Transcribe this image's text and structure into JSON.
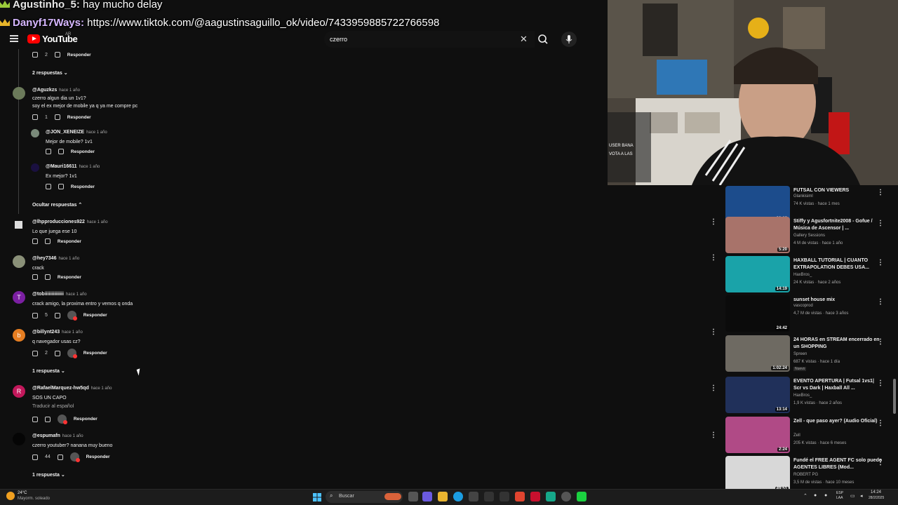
{
  "chat": {
    "line1_user": "Agustinho_5:",
    "line1_msg": "hay mucho delay",
    "line2_user": "Danyf17Ways:",
    "line2_msg": "https://www.tiktok.com/@aagustinsaguillo_ok/video/7433959885722766598"
  },
  "header": {
    "logo_text": "YouTube",
    "country": "AR",
    "search_value": "czerro"
  },
  "comments": [
    {
      "likes": "2",
      "reply": "Responder"
    },
    {
      "user": "@Aguzkzs",
      "time": "hace 1 año",
      "text1": "czerro algun dia un 1v1?",
      "text2": "soy el ex mejor de mobile ya q ya me compre pc",
      "likes": "1",
      "reply": "Responder"
    },
    {
      "user": "@JON_XENEIZE",
      "time": "hace 1 año",
      "text1": "Mejor de mobile? 1v1",
      "reply": "Responder"
    },
    {
      "user": "@Mauri16611",
      "time": "hace 1 año",
      "text1": "Ex mejor? 1v1",
      "reply": "Responder"
    },
    {
      "user": "@lhpproducciones922",
      "time": "hace 1 año",
      "text1": "Lo que juega ese 10",
      "reply": "Responder"
    },
    {
      "user": "@hey7346",
      "time": "hace 1 año",
      "text1": "crack",
      "reply": "Responder"
    },
    {
      "user": "@tobiiiiiiiiiiiiii",
      "time": "hace 1 año",
      "text1": "crack amigo, la proxima entro y vemos q onda",
      "likes": "5",
      "reply": "Responder"
    },
    {
      "user": "@billynt243",
      "time": "hace 1 año",
      "text1": "q navegador usas cz?",
      "likes": "2",
      "reply": "Responder"
    },
    {
      "user": "@RafaelMarquez-hw5qd",
      "time": "hace 1 año",
      "text1": "SOS UN CAPO",
      "translate": "Traducir al español",
      "reply": "Responder"
    },
    {
      "user": "@espumafn",
      "time": "hace 1 año",
      "text1": "czerro youtuber? nanana muy bueno",
      "likes": "44",
      "reply": "Responder"
    }
  ],
  "toggles": {
    "replies_2": "2 respuestas",
    "hide_replies": "Ocultar respuestas",
    "replies_1a": "1 respuesta",
    "replies_1b": "1 respuesta"
  },
  "overlay": {
    "l1": "USER BANA",
    "l2": "VOTA A LAS"
  },
  "videos": [
    {
      "title": "FUTSAL CON VIEWERS",
      "channel": "Glankisiml",
      "meta": "74 K vistas · hace 1 mes",
      "duration": "30:18",
      "thumb": "#1c4c8c"
    },
    {
      "title": "Stiffy y Agusfortnite2008 - Gofue / Música de Ascensor | ...",
      "channel": "Gallery Sessions",
      "meta": "4 M de vistas · hace 1 año",
      "duration": "5:20",
      "thumb": "#a8736a"
    },
    {
      "title": "HAXBALL TUTORIAL | CUANTO EXTRAPOLATION DEBES USA...",
      "channel": "HaxBros_",
      "meta": "24 K vistas · hace 2 años",
      "duration": "14:19",
      "thumb": "#1aa3a9"
    },
    {
      "title": "sunset house mix",
      "channel": "vascoprod",
      "meta": "4,7 M de vistas · hace 3 años",
      "duration": "24:42",
      "thumb": "#0b0b0b"
    },
    {
      "title": "24 HORAS en STREAM encerrado en un SHOPPING",
      "channel": "Spreen",
      "meta": "687 K vistas · hace 1 día",
      "badge": "Nuevo",
      "duration": "1:02:24",
      "thumb": "#6e6a62"
    },
    {
      "title": "EVENTO APERTURA | Futsal 1vs1| Scr vs Dark | Haxball All ...",
      "channel": "HaxBros_",
      "meta": "1,9 K vistas · hace 2 años",
      "duration": "13:14",
      "thumb": "#20305a"
    },
    {
      "title": "Zell - que paso ayer? (Audio Oficial)",
      "channel": "Zell",
      "meta": "205 K vistas · hace 6 meses",
      "duration": "2:24",
      "thumb": "#b04a86"
    },
    {
      "title": "Fundé el FREE AGENT FC solo puedo AGENTES LIBRES (Mod...",
      "channel": "ROBERT PG",
      "meta": "3,5 M de vistas · hace 10 meses",
      "duration": "49:51",
      "thumb": "#d8d8d8"
    }
  ],
  "taskbar": {
    "temp": "24°C",
    "weather": "Mayorm. soleado",
    "search": "Buscar",
    "lang1": "ESP",
    "lang2": "LAA",
    "time": "14:24",
    "date": "28/2/2025"
  },
  "colors": {
    "bg": "#0f0f0f",
    "accent": "#ff0000",
    "text": "#f1f1f1",
    "muted": "#aaaaaa"
  }
}
